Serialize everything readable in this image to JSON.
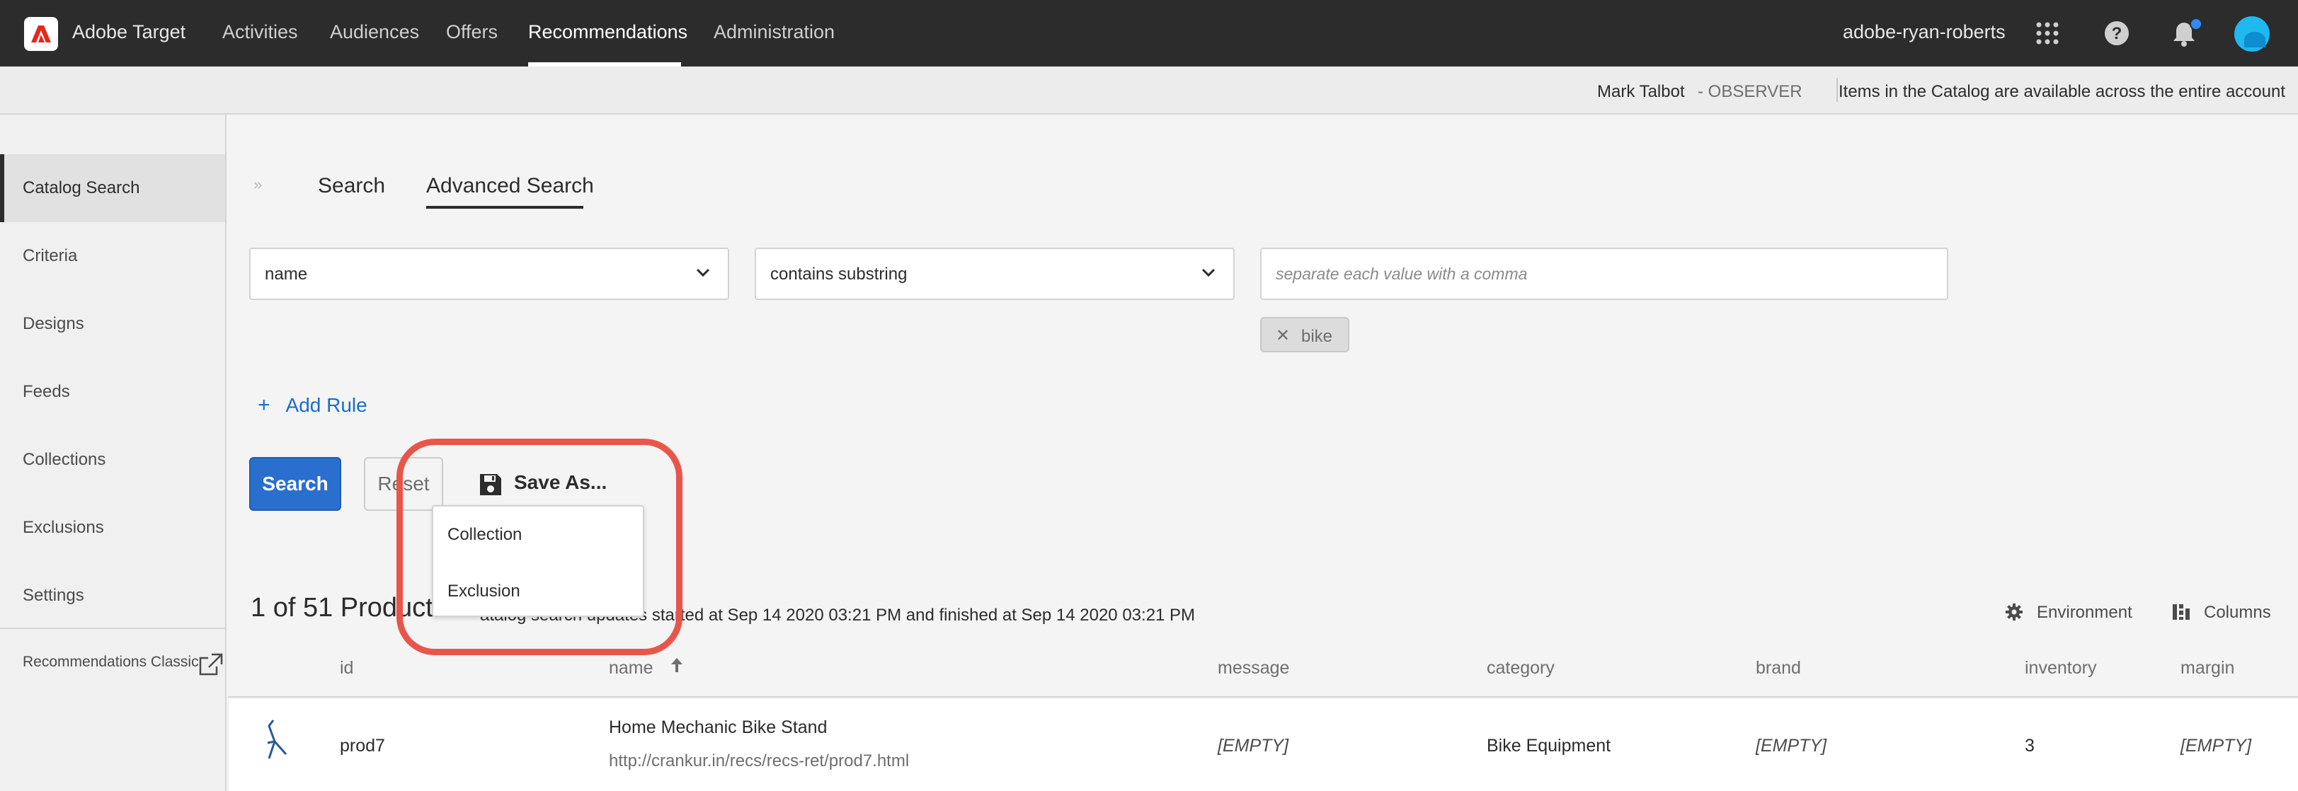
{
  "app": {
    "name": "Adobe Target",
    "logo_icon": "adobe-logo-icon"
  },
  "nav": {
    "items": [
      "Activities",
      "Audiences",
      "Offers",
      "Recommendations",
      "Administration"
    ],
    "active": "Recommendations",
    "org": "adobe-ryan-roberts",
    "icons": [
      "apps-grid-icon",
      "help-icon",
      "bell-icon",
      "avatar"
    ]
  },
  "subheader": {
    "user": "Mark Talbot",
    "role": " - OBSERVER",
    "note": "Items in the Catalog are available across the entire account"
  },
  "sidebar": {
    "items": [
      "Catalog Search",
      "Criteria",
      "Designs",
      "Feeds",
      "Collections",
      "Exclusions",
      "Settings"
    ],
    "active": "Catalog Search",
    "classic_link": "Recommendations Classic"
  },
  "main": {
    "tabs": [
      "Search",
      "Advanced Search"
    ],
    "active_tab": "Advanced Search",
    "rule": {
      "attribute": "name",
      "operator": "contains substring",
      "value_placeholder": "separate each value with a comma",
      "value_tags": [
        "bike"
      ]
    },
    "add_rule": "Add Rule",
    "buttons": {
      "search": "Search",
      "reset": "Reset",
      "save_as": "Save As..."
    },
    "save_as_menu": [
      "Collection",
      "Exclusion"
    ],
    "results": {
      "count": "1 of 51 Products",
      "status": "Catalog search updates started at Sep 14 2020 03:21 PM and finished at Sep 14 2020 03:21 PM",
      "status_visible": "atalog search updates started at Sep 14 2020 03:21 PM and finished at Sep 14 2020 03:21 PM"
    },
    "toolbar": {
      "environment": "Environment",
      "columns": "Columns"
    }
  },
  "table": {
    "columns": [
      "id",
      "name",
      "message",
      "category",
      "brand",
      "inventory",
      "margin"
    ],
    "sort": {
      "column": "name",
      "direction": "ascending"
    },
    "rows": [
      {
        "id": "prod7",
        "name": "Home Mechanic Bike Stand",
        "url": "http://crankur.in/recs/recs-ret/prod7.html",
        "message": "[EMPTY]",
        "category": "Bike Equipment",
        "brand": "[EMPTY]",
        "inventory": "3",
        "margin": "[EMPTY]"
      }
    ]
  },
  "colors": {
    "topbar": "#2c2c2c",
    "primary": "#2b6fce",
    "link": "#1a6cc8",
    "highlight": "#e8564a"
  }
}
